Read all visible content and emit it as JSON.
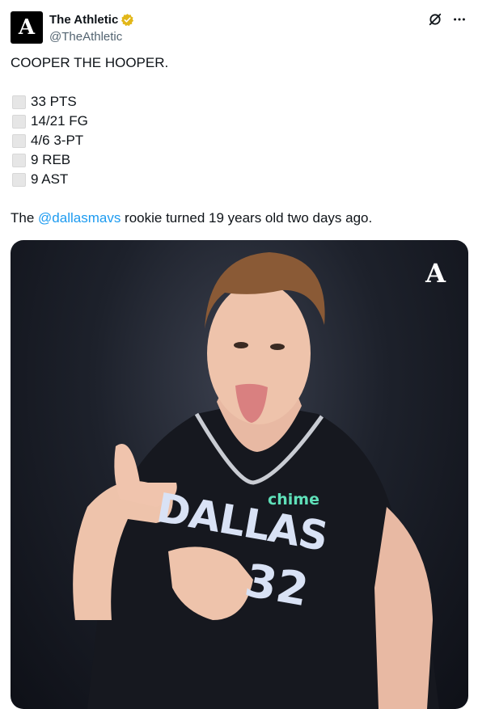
{
  "account": {
    "display_name": "The Athletic",
    "handle": "@TheAthletic",
    "avatar_letter": "A",
    "verified_color": "#e2b719"
  },
  "tweet": {
    "title": "COOPER THE HOOPER.",
    "stats": [
      "33 PTS",
      "14/21 FG",
      "4/6 3-PT",
      "9 REB",
      "9 AST"
    ],
    "sentence_before": "The ",
    "mention": "@dallasmavs",
    "sentence_after": " rookie turned 19 years old two days ago."
  },
  "media": {
    "watermark_letter": "A",
    "jersey_text": "DALLAS",
    "jersey_number": "32",
    "sponsor_text": "chime"
  },
  "icons": {
    "verified": "verified-badge-icon",
    "grok": "grok-icon",
    "more": "more-icon"
  },
  "colors": {
    "link": "#1d9bf0",
    "secondary_text": "#536471"
  }
}
